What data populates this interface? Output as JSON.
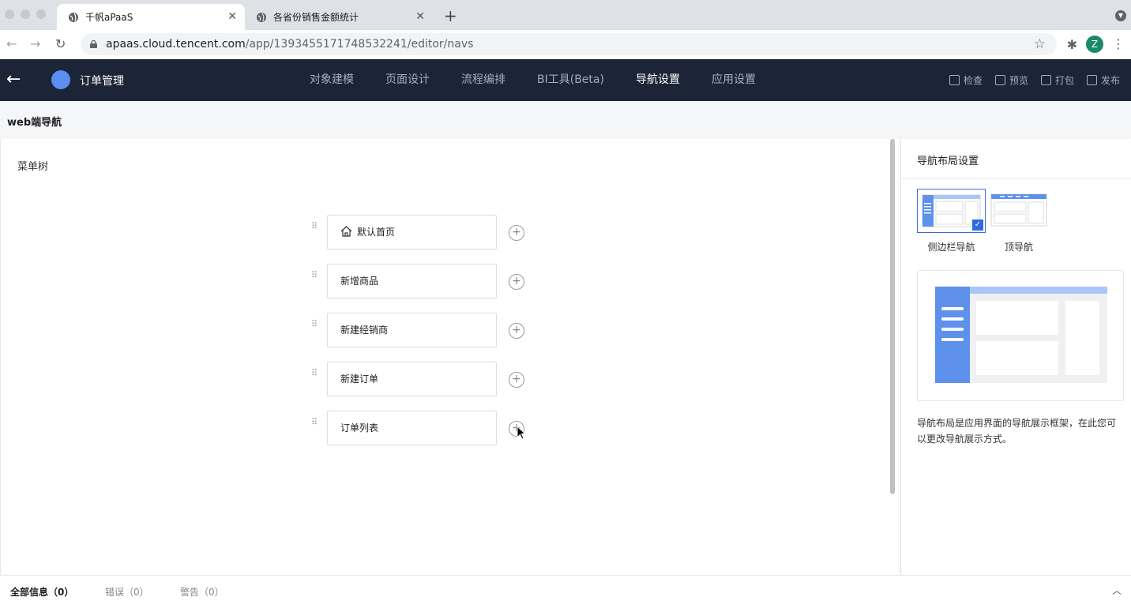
{
  "browser": {
    "tabs": [
      {
        "title": "千帆aPaaS",
        "active": true
      },
      {
        "title": "各省份销售金额统计",
        "active": false
      }
    ],
    "url_host": "apaas.cloud.tencent.com",
    "url_path": "/app/1393455171748532241/editor/navs",
    "profile_initial": "Z"
  },
  "header": {
    "app_name": "订单管理",
    "nav": [
      {
        "label": "对象建模",
        "active": false
      },
      {
        "label": "页面设计",
        "active": false
      },
      {
        "label": "流程编排",
        "active": false
      },
      {
        "label": "BI工具(Beta)",
        "active": false
      },
      {
        "label": "导航设置",
        "active": true
      },
      {
        "label": "应用设置",
        "active": false
      }
    ],
    "actions": [
      "检查",
      "预览",
      "打包",
      "发布"
    ]
  },
  "subheader": {
    "title": "web端导航"
  },
  "canvas": {
    "tree_label": "菜单树",
    "menu_items": [
      {
        "label": "默认首页",
        "icon": "home-icon"
      },
      {
        "label": "新增商品",
        "icon": ""
      },
      {
        "label": "新建经销商",
        "icon": ""
      },
      {
        "label": "新建订单",
        "icon": ""
      },
      {
        "label": "订单列表",
        "icon": ""
      }
    ]
  },
  "right_panel": {
    "title": "导航布局设置",
    "options": [
      {
        "label": "侧边栏导航",
        "selected": true
      },
      {
        "label": "顶导航",
        "selected": false
      }
    ],
    "description": "导航布局是应用界面的导航展示框架，在此您可以更改导航展示方式。"
  },
  "bottom": {
    "tabs": [
      {
        "label": "全部信息（0）",
        "active": true
      },
      {
        "label": "错误（0）",
        "active": false
      },
      {
        "label": "警告（0）",
        "active": false
      }
    ]
  },
  "colors": {
    "header_bg": "#1c2538",
    "accent": "#2f6ae0",
    "preview_blue": "#5d91ec",
    "preview_light": "#a9c5f6"
  }
}
